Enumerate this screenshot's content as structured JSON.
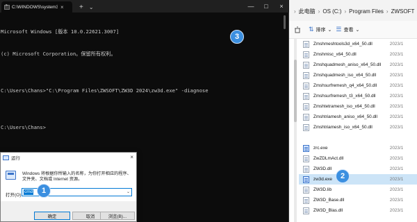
{
  "terminal": {
    "tab_title": "C:\\WINDOWS\\system32\\cmd.",
    "tab_close": "×",
    "new_tab": "+",
    "dropdown": "⌄",
    "controls": [
      "—",
      "□",
      "×"
    ],
    "lines": [
      "Microsoft Windows [版本 10.0.22621.3007]",
      "(c) Microsoft Corporation。保留所有权利。",
      "",
      "C:\\Users\\Chans>\"C:\\Program Files\\ZWSOFT\\ZW3D 2024\\zw3d.exe\" -diagnose",
      "",
      "C:\\Users\\Chans>"
    ]
  },
  "explorer": {
    "breadcrumb": [
      "此电脑",
      "OS (C:)",
      "Program Files",
      "ZWSOFT"
    ],
    "toolbar": {
      "sort_label": "排序",
      "view_label": "查看"
    },
    "files": [
      {
        "name": "Zmshmeshtools3d_x64_50.dll",
        "date": "2023/1"
      },
      {
        "name": "Zmshmisc_x64_50.dll",
        "date": "2023/1"
      },
      {
        "name": "Zmshquadmesh_aniso_x64_50.dll",
        "date": "2023/1"
      },
      {
        "name": "Zmshquadmesh_iso_x64_50.dll",
        "date": "2023/1"
      },
      {
        "name": "Zmshsurfremesh_q4_x64_50.dll",
        "date": "2023/1"
      },
      {
        "name": "Zmshsurfremesh_t3_x64_50.dll",
        "date": "2023/1"
      },
      {
        "name": "Zmshtetramesh_iso_x64_50.dll",
        "date": "2023/1"
      },
      {
        "name": "Zmshtriamesh_aniso_x64_50.dll",
        "date": "2023/1"
      },
      {
        "name": "Zmshtriamesh_iso_x64_50.dll",
        "date": "2023/1"
      },
      {
        "name": "",
        "date": ""
      },
      {
        "name": "zrc.exe",
        "date": "2023/1"
      },
      {
        "name": "ZwZDLmAct.dll",
        "date": "2023/1"
      },
      {
        "name": "ZW3D.dll",
        "date": "2023/1"
      },
      {
        "name": "zw3d.exe",
        "date": "2023/1"
      },
      {
        "name": "ZW3D.lib",
        "date": "2023/1"
      },
      {
        "name": "ZW3D_Base.dll",
        "date": "2023/1"
      },
      {
        "name": "ZW3D_Blas.dll",
        "date": "2023/1"
      }
    ]
  },
  "run_dialog": {
    "title": "运行",
    "close": "×",
    "description": "Windows 将根据你所输入的名称，为你打开相应的程序、文件夹、文档或 Internet 资源。",
    "open_label": "打开(O):",
    "input_value": "cmd",
    "ok_label": "确定",
    "cancel_label": "取消",
    "browse_label": "浏览(B)..."
  },
  "badges": [
    "1",
    "2",
    "3"
  ],
  "colors": {
    "terminal_bg": "#0c0c0c",
    "badge": "#3b8fe0",
    "selection": "#cce4f7"
  }
}
